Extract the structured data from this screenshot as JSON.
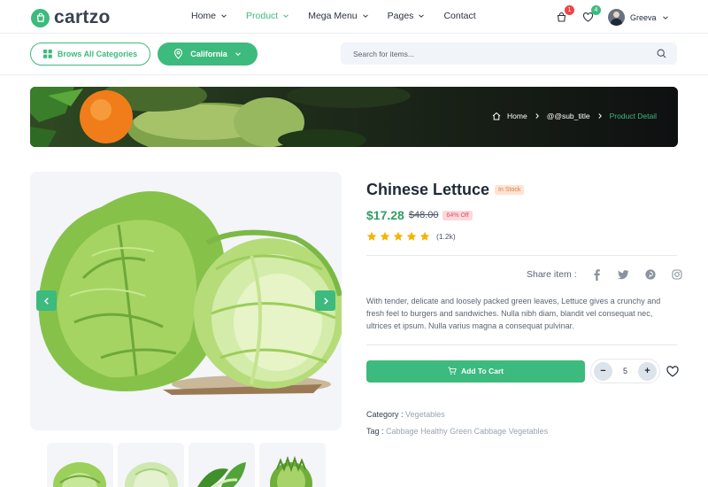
{
  "brand": {
    "name": "cartzo",
    "accent": "#3dba7d"
  },
  "nav": [
    {
      "label": "Home",
      "has_dropdown": true,
      "active": false
    },
    {
      "label": "Product",
      "has_dropdown": true,
      "active": true
    },
    {
      "label": "Mega Menu",
      "has_dropdown": true,
      "active": false
    },
    {
      "label": "Pages",
      "has_dropdown": true,
      "active": false
    },
    {
      "label": "Contact",
      "has_dropdown": false,
      "active": false
    }
  ],
  "header": {
    "cart_count": "1",
    "wishlist_count": "4",
    "user_name": "Greeva",
    "icons": [
      "cart-icon",
      "heart-icon",
      "avatar",
      "chevron-down-icon"
    ]
  },
  "subbar": {
    "categories_label": "Brows All Categories",
    "location_label": "California",
    "search_placeholder": "Search for items..."
  },
  "breadcrumb": {
    "items": [
      "Home",
      "@@sub_title",
      "Product Detail"
    ]
  },
  "product": {
    "title": "Chinese Lettuce",
    "stock_status": "In Stock",
    "price": "$17.28",
    "old_price": "$48.00",
    "discount": "64% Off",
    "rating": 5,
    "review_count": "(1.2k)",
    "share_label": "Share item :",
    "share_icons": [
      "facebook-icon",
      "twitter-icon",
      "pinterest-icon",
      "instagram-icon"
    ],
    "description": "With tender, delicate and loosely packed green leaves, Lettuce gives a crunchy and fresh feel to burgers and sandwiches. Nulla nibh diam, blandit vel consequat nec, ultrices et ipsum. Nulla varius magna a consequat pulvinar.",
    "add_to_cart_label": "Add To Cart",
    "quantity": "5",
    "qty_minus": "−",
    "qty_plus": "+",
    "category_label": "Category :",
    "category_value": "Vegetables",
    "tag_label": "Tag :",
    "tag_value": "Cabbage Healthy Green Cabbage Vegetables"
  }
}
